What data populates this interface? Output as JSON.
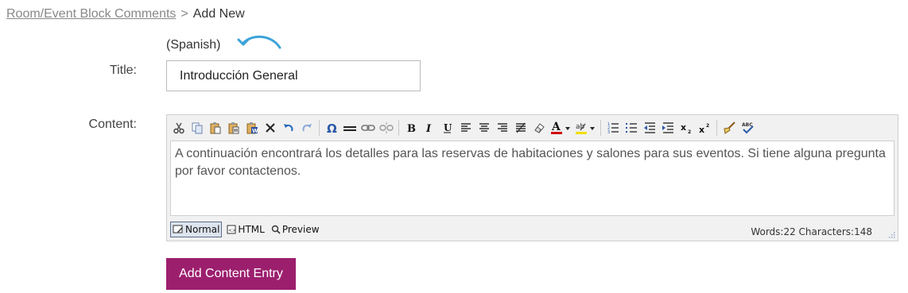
{
  "breadcrumb": {
    "parent": "Room/Event Block Comments",
    "separator": ">",
    "current": "Add New"
  },
  "language": {
    "label": "(Spanish)"
  },
  "form": {
    "title_label": "Title:",
    "title_value": "Introducción General",
    "content_label": "Content:"
  },
  "editor": {
    "toolbar_icons": [
      "cut-icon",
      "copy-icon",
      "paste-icon",
      "paste-text-icon",
      "paste-word-icon",
      "delete-icon",
      "undo-icon",
      "redo-icon",
      "special-char-icon",
      "horizontal-rule-icon",
      "link-icon",
      "unlink-icon",
      "bold-icon",
      "italic-icon",
      "underline-icon",
      "align-left-icon",
      "align-center-icon",
      "align-right-icon",
      "justify-icon",
      "clear-format-icon",
      "font-color-icon",
      "highlight-icon",
      "ordered-list-icon",
      "unordered-list-icon",
      "outdent-icon",
      "indent-icon",
      "subscript-icon",
      "superscript-icon",
      "cleanup-icon",
      "spellcheck-icon"
    ],
    "content_text": "A continuación encontrará los detalles para las reservas de habitaciones y salones para sus eventos. Si tiene alguna pregunta por favor contactenos.",
    "modes": {
      "normal": "Normal",
      "html": "HTML",
      "preview": "Preview"
    },
    "stats": "Words:22 Characters:148"
  },
  "actions": {
    "submit_label": "Add Content Entry"
  },
  "colors": {
    "accent": "#9c1f6e",
    "arrow": "#3ba3d8",
    "font_color_bar": "#d00000",
    "highlight_bar": "#f0e000"
  }
}
